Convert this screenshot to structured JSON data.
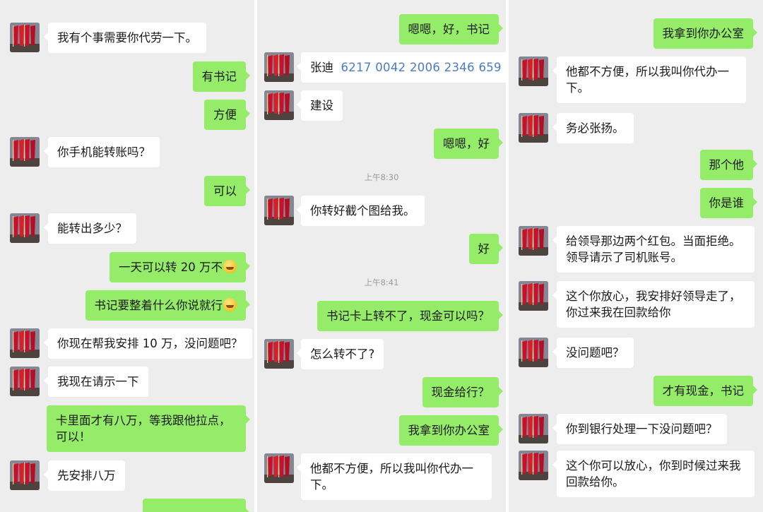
{
  "panel1": {
    "messages": [
      {
        "side": "left",
        "text": "我有个事需要你代劳一下。"
      },
      {
        "side": "right",
        "text": "有书记"
      },
      {
        "side": "right",
        "text": "方便"
      },
      {
        "side": "left",
        "text": "你手机能转账吗？"
      },
      {
        "side": "right",
        "text": "可以"
      },
      {
        "side": "left",
        "text": "能转出多少？"
      },
      {
        "side": "right",
        "text": "一天可以转 20 万不",
        "emoji": "grin-emoji"
      },
      {
        "side": "right",
        "text": "书记要整着什么你说就行",
        "emoji": "smile-emoji"
      },
      {
        "side": "left",
        "text": "你现在帮我安排 10 万，没问题吧？"
      },
      {
        "side": "left",
        "text": "我现在请示一下"
      },
      {
        "side": "right",
        "text": "卡里面才有八万，等我跟他拉点，可以！"
      },
      {
        "side": "left",
        "text": "先安排八万"
      }
    ]
  },
  "panel2": {
    "messages": [
      {
        "side": "right",
        "text": "嗯嗯，好，书记"
      },
      {
        "side": "left",
        "text": "张迪",
        "account": "6217 0042 2006 2346 659"
      },
      {
        "side": "left",
        "text": "建设"
      },
      {
        "side": "right",
        "text": "嗯嗯，好"
      },
      {
        "side": "left",
        "text": "你转好截个图给我。"
      },
      {
        "side": "right",
        "text": "好"
      },
      {
        "side": "right",
        "text": "书记卡上转不了，现金可以吗？"
      },
      {
        "side": "left",
        "text": "怎么转不了?"
      },
      {
        "side": "right",
        "text": "现金给行？"
      },
      {
        "side": "right",
        "text": "我拿到你办公室"
      },
      {
        "side": "left",
        "text": "他都不方便，所以我叫你代办一下。"
      }
    ],
    "timestamps": [
      "上午8:30",
      "上午8:41"
    ]
  },
  "panel3": {
    "messages": [
      {
        "side": "right",
        "text": "我拿到你办公室"
      },
      {
        "side": "left",
        "text": "他都不方便，所以我叫你代办一下。"
      },
      {
        "side": "left",
        "text": "务必张扬。"
      },
      {
        "side": "right",
        "text": "那个他"
      },
      {
        "side": "right",
        "text": "你是谁"
      },
      {
        "side": "left",
        "text": "给领导那边两个红包。当面拒绝。领导请示了司机账号。"
      },
      {
        "side": "left",
        "text": "这个你放心，我安排好领导走了，你过来我在回款给你"
      },
      {
        "side": "left",
        "text": "没问题吧？"
      },
      {
        "side": "right",
        "text": "才有现金，书记"
      },
      {
        "side": "left",
        "text": "你到银行处理一下没问题吧？"
      },
      {
        "side": "left",
        "text": "这个你可以放心，你到时候过来我回款给你。"
      }
    ]
  },
  "colors": {
    "panel_background": "#ededed",
    "sent_bubble": "#95ec69",
    "received_bubble": "#ffffff",
    "account_link": "#4a7cc5"
  },
  "icons": {
    "avatar": "avatar-red-flags-icon"
  }
}
